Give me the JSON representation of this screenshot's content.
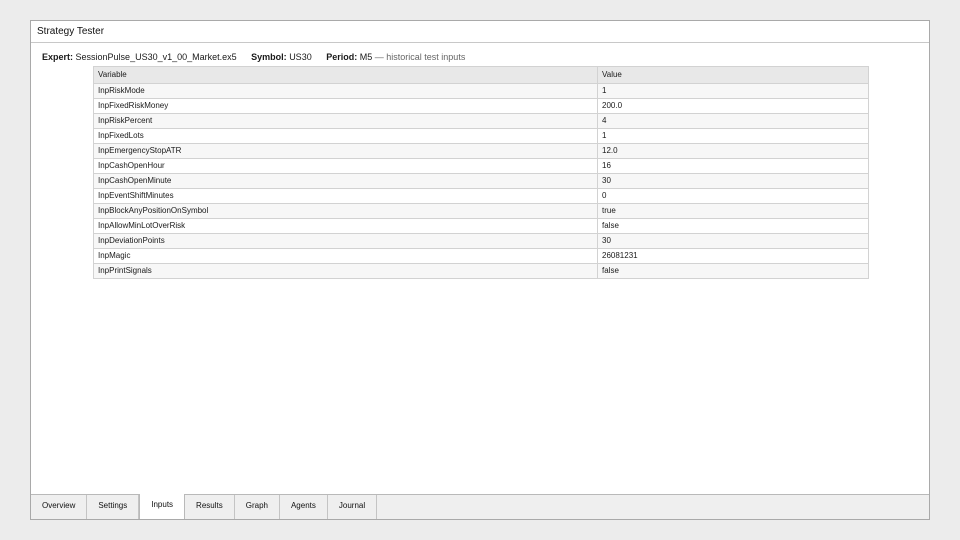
{
  "window": {
    "title": "Strategy Tester"
  },
  "info": {
    "expert_label": "Expert:",
    "expert_value": "SessionPulse_US30_v1_00_Market.ex5",
    "symbol_label": "Symbol:",
    "symbol_value": "US30",
    "period_label": "Period:",
    "period_value": "M5",
    "note": "— historical test inputs"
  },
  "table": {
    "columns": [
      "Variable",
      "Value"
    ],
    "rows": [
      [
        "InpRiskMode",
        "1"
      ],
      [
        "InpFixedRiskMoney",
        "200.0"
      ],
      [
        "InpRiskPercent",
        "4"
      ],
      [
        "InpFixedLots",
        "1"
      ],
      [
        "InpEmergencyStopATR",
        "12.0"
      ],
      [
        "InpCashOpenHour",
        "16"
      ],
      [
        "InpCashOpenMinute",
        "30"
      ],
      [
        "InpEventShiftMinutes",
        "0"
      ],
      [
        "InpBlockAnyPositionOnSymbol",
        "true"
      ],
      [
        "InpAllowMinLotOverRisk",
        "false"
      ],
      [
        "InpDeviationPoints",
        "30"
      ],
      [
        "InpMagic",
        "26081231"
      ],
      [
        "InpPrintSignals",
        "false"
      ]
    ]
  },
  "tabs": [
    {
      "label": "Overview",
      "active": false
    },
    {
      "label": "Settings",
      "active": false
    },
    {
      "label": "Inputs",
      "active": true
    },
    {
      "label": "Results",
      "active": false
    },
    {
      "label": "Graph",
      "active": false
    },
    {
      "label": "Agents",
      "active": false
    },
    {
      "label": "Journal",
      "active": false
    }
  ]
}
